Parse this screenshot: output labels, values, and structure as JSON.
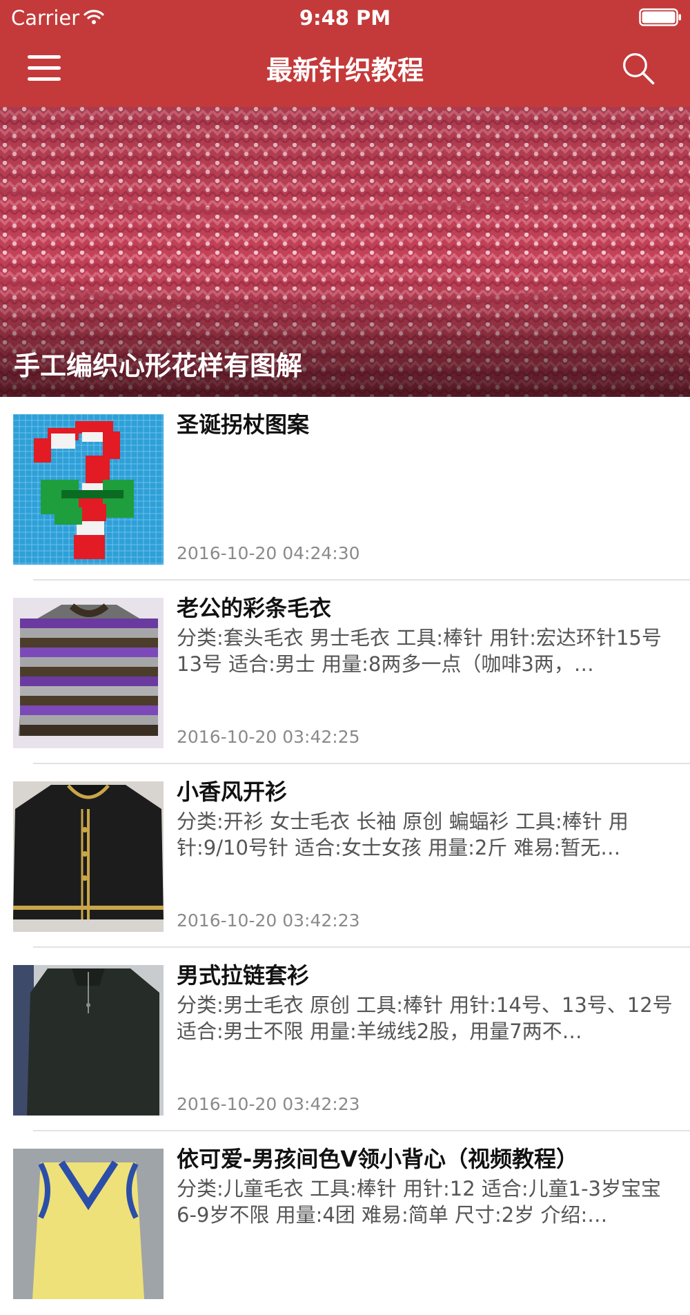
{
  "status_bar": {
    "carrier": "Carrier",
    "time": "9:48 PM"
  },
  "nav": {
    "title": "最新针织教程",
    "menu_icon": "hamburger-menu-icon",
    "search_icon": "search-icon"
  },
  "hero": {
    "title": "手工编织心形花样有图解"
  },
  "items": [
    {
      "title": "圣诞拐杖图案",
      "desc": "",
      "time": "2016-10-20 04:24:30"
    },
    {
      "title": "老公的彩条毛衣",
      "desc": "分类:套头毛衣 男士毛衣 工具:棒针 用针:宏达环针15号13号 适合:男士 用量:8两多一点（咖啡3两，…",
      "time": "2016-10-20 03:42:25"
    },
    {
      "title": "小香风开衫",
      "desc": "分类:开衫 女士毛衣 长袖 原创 蝙蝠衫 工具:棒针 用针:9/10号针 适合:女士女孩 用量:2斤 难易:暂无…",
      "time": "2016-10-20 03:42:23"
    },
    {
      "title": "男式拉链套衫",
      "desc": "分类:男士毛衣 原创 工具:棒针 用针:14号、13号、12号 适合:男士不限 用量:羊绒线2股，用量7两不…",
      "time": "2016-10-20 03:42:23"
    },
    {
      "title": "依可爱-男孩间色V领小背心（视频教程）",
      "desc": "分类:儿童毛衣 工具:棒针 用针:12 适合:儿童1-3岁宝宝6-9岁不限 用量:4团 难易:简单 尺寸:2岁 介绍:…",
      "time": ""
    }
  ],
  "colors": {
    "nav_bg": "#c43a3a",
    "hero_bg": "#c9445a"
  }
}
